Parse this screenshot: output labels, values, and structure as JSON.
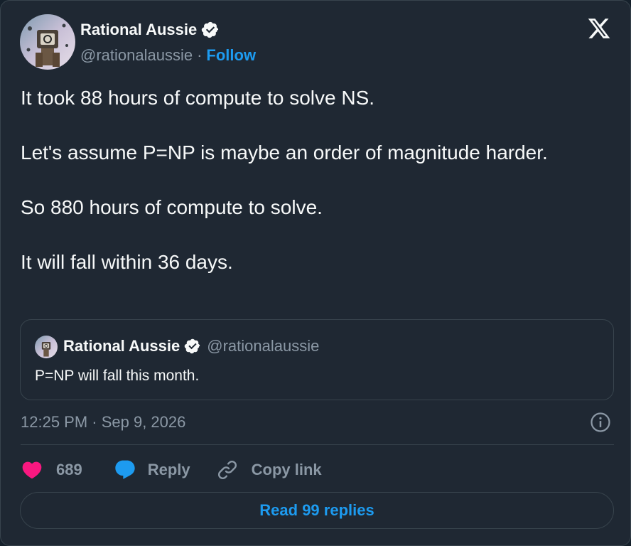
{
  "author": {
    "name": "Rational Aussie",
    "handle": "@rationalaussie",
    "separator": "·",
    "follow_label": "Follow"
  },
  "tweet": {
    "paragraphs": [
      "It took 88 hours of compute to solve NS.",
      "Let's assume P=NP is maybe an order of magnitude harder.",
      "So 880 hours of compute to solve.",
      "It will fall within 36 days."
    ],
    "timestamp": "12:25 PM · Sep 9, 2026"
  },
  "quoted_tweet": {
    "name": "Rational Aussie",
    "handle": "@rationalaussie",
    "text": "P=NP will fall this month."
  },
  "actions": {
    "like_count": "689",
    "reply_label": "Reply",
    "copy_label": "Copy link"
  },
  "read_replies_label": "Read 99 replies",
  "colors": {
    "background": "#1f2833",
    "accent": "#1d9bf0",
    "like": "#f91880",
    "muted": "#8b98a5",
    "text": "#f7f9f9",
    "border": "#38444d"
  },
  "icons": {
    "verified": "verified-badge-icon",
    "x_logo": "x-logo-icon",
    "info": "info-icon",
    "like": "heart-icon",
    "reply": "speech-bubble-icon",
    "copy": "link-icon"
  }
}
